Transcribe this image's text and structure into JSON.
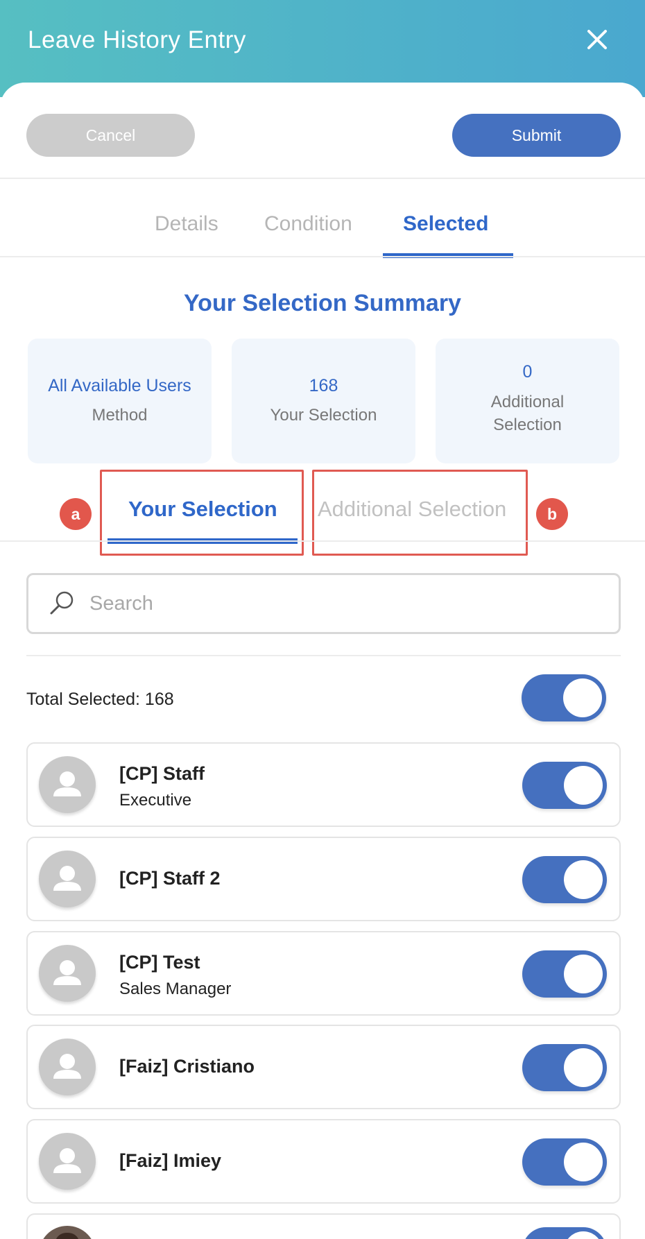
{
  "header": {
    "title": "Leave History Entry"
  },
  "actions": {
    "cancel_label": "Cancel",
    "submit_label": "Submit"
  },
  "tabs": [
    {
      "label": "Details"
    },
    {
      "label": "Condition"
    },
    {
      "label": "Selected"
    }
  ],
  "summary": {
    "title": "Your Selection Summary",
    "cards": [
      {
        "value": "All Available Users",
        "label": "Method"
      },
      {
        "value": "168",
        "label": "Your Selection"
      },
      {
        "value": "0",
        "label": "Additional Selection"
      }
    ]
  },
  "subtabs": [
    {
      "label": "Your Selection",
      "marker": "a"
    },
    {
      "label": "Additional Selection",
      "marker": "b"
    }
  ],
  "search": {
    "placeholder": "Search",
    "value": ""
  },
  "total": {
    "label": "Total Selected: 168"
  },
  "users": [
    {
      "name": "[CP] Staff",
      "role": "Executive"
    },
    {
      "name": "[CP] Staff 2",
      "role": ""
    },
    {
      "name": "[CP] Test",
      "role": "Sales Manager"
    },
    {
      "name": "[Faiz] Cristiano",
      "role": ""
    },
    {
      "name": "[Faiz] Imiey",
      "role": ""
    }
  ],
  "colors": {
    "accent": "#2f67c9",
    "toggle": "#4570bf",
    "highlight": "#e05a52"
  }
}
